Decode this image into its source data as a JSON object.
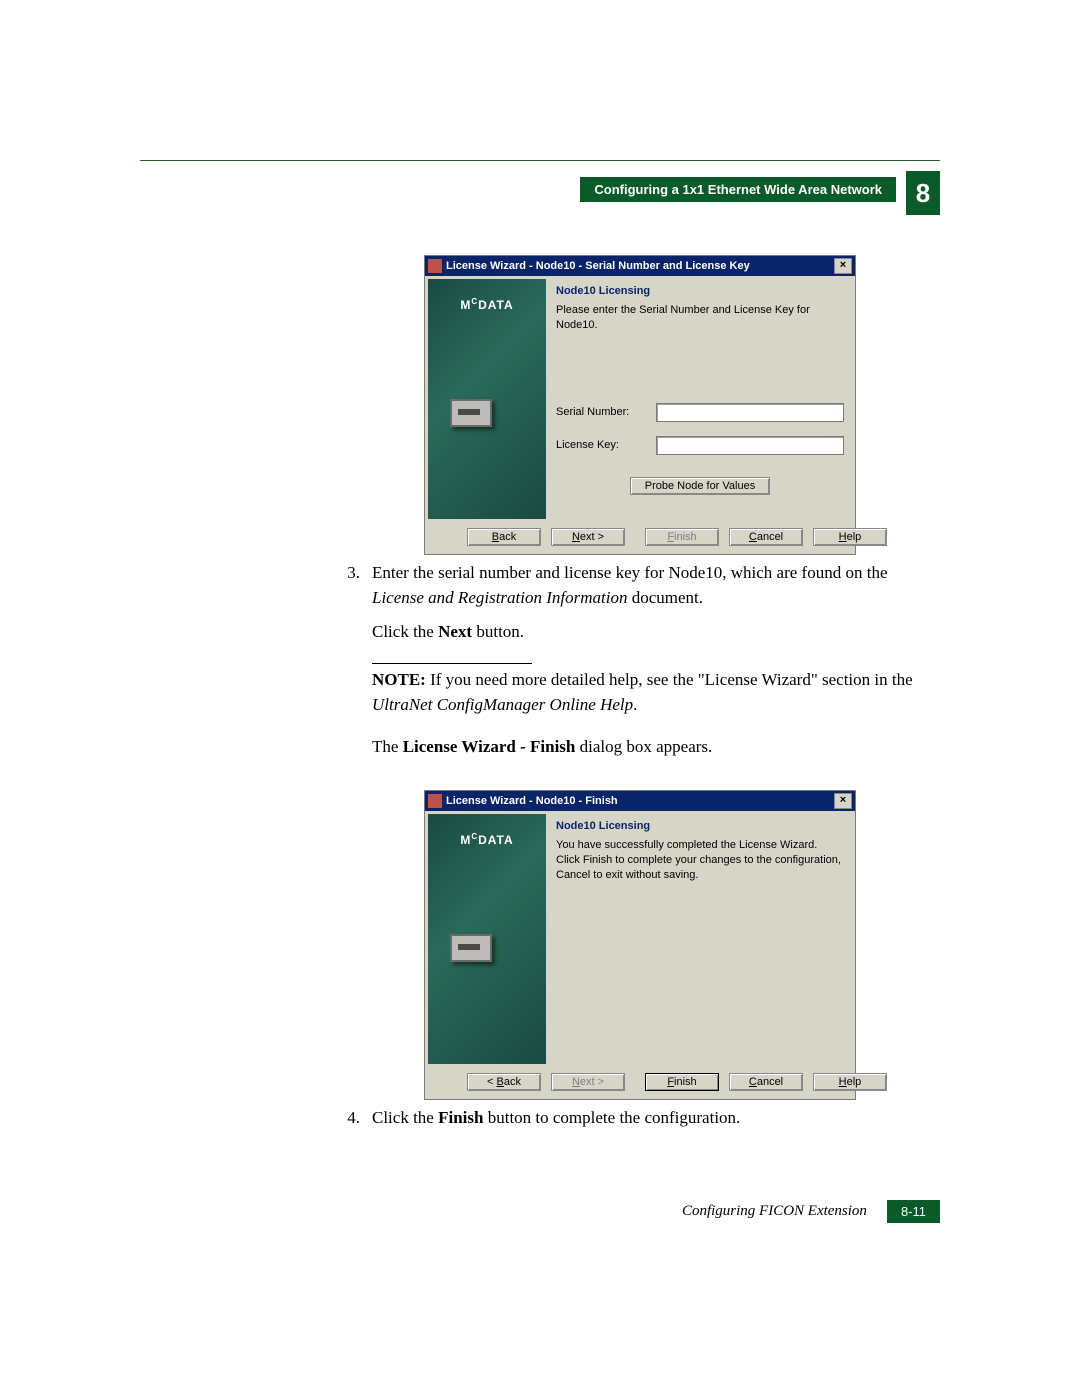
{
  "header": {
    "section_title": "Configuring a 1x1 Ethernet Wide Area Network",
    "chapter_number": "8"
  },
  "dialog1": {
    "title": "License Wizard - Node10 - Serial Number and License Key",
    "logo": "MCDATA",
    "heading": "Node10 Licensing",
    "description": "Please enter the Serial Number and License Key for Node10.",
    "field_serial_label": "Serial Number:",
    "field_license_label": "License Key:",
    "probe_button": "Probe Node for Values",
    "btn_back": "< Back",
    "btn_next": "Next >",
    "btn_finish": "Finish",
    "btn_cancel": "Cancel",
    "btn_help": "Help"
  },
  "step3": {
    "number": "3.",
    "line1a": "Enter the serial number and license key for Node10, which are found on the ",
    "line1b": "License and Registration Information",
    "line1c": " document.",
    "line2a": "Click the ",
    "line2b": "Next",
    "line2c": " button."
  },
  "note": {
    "prefix": "NOTE:",
    "text_a": " If you need more detailed help, see the \"License Wizard\" section in the ",
    "text_b": "UltraNet ConfigManager Online Help",
    "text_c": "."
  },
  "para1": {
    "a": "The ",
    "b": "License Wizard - Finish",
    "c": " dialog box appears."
  },
  "dialog2": {
    "title": "License Wizard - Node10 - Finish",
    "logo": "MCDATA",
    "heading": "Node10 Licensing",
    "description": "You have successfully completed the License Wizard. Click Finish to complete your changes to the configuration, Cancel to exit without saving.",
    "btn_back": "< Back",
    "btn_next": "Next >",
    "btn_finish": "Finish",
    "btn_cancel": "Cancel",
    "btn_help": "Help"
  },
  "step4": {
    "number": "4.",
    "a": "Click the ",
    "b": "Finish",
    "c": " button to complete the configuration."
  },
  "footer": {
    "title": "Configuring FICON Extension",
    "page": "8-11"
  }
}
